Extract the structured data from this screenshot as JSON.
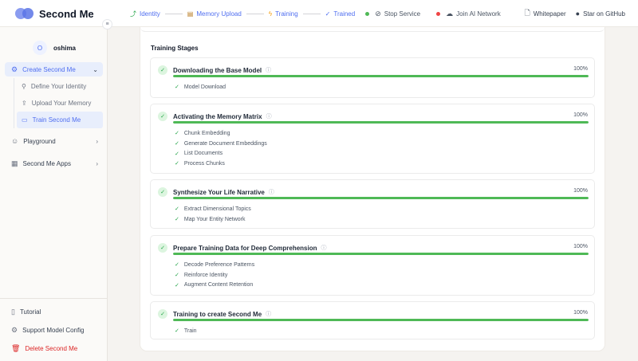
{
  "app": {
    "name": "Second Me"
  },
  "header": {
    "steps": [
      {
        "icon": "chart-up-icon",
        "label": "Identity"
      },
      {
        "icon": "memory-icon",
        "label": "Memory Upload"
      },
      {
        "icon": "bolt-icon",
        "label": "Training"
      },
      {
        "icon": "check-icon",
        "label": "Trained"
      }
    ],
    "actions": [
      {
        "label": "Stop Service",
        "dot_color": "#4fb956"
      },
      {
        "label": "Join AI Network",
        "dot_color": "#ef4444"
      }
    ],
    "links": [
      {
        "label": "Whitepaper"
      },
      {
        "label": "Star on GitHub"
      }
    ]
  },
  "sidebar": {
    "user": {
      "avatar_letter": "O",
      "name": "oshima"
    },
    "create": {
      "label": "Create Second Me",
      "children": [
        {
          "label": "Define Your Identity"
        },
        {
          "label": "Upload Your Memory"
        },
        {
          "label": "Train Second Me"
        }
      ]
    },
    "playground": {
      "label": "Playground"
    },
    "apps": {
      "label": "Second Me Apps"
    },
    "bottom": [
      {
        "label": "Tutorial"
      },
      {
        "label": "Support Model Config"
      },
      {
        "label": "Delete Second Me"
      }
    ]
  },
  "main": {
    "section_title": "Training Stages",
    "stages": [
      {
        "name": "Downloading the Base Model",
        "percent_text": "100%",
        "progress": 1.0,
        "tasks": [
          "Model Download"
        ]
      },
      {
        "name": "Activating the Memory Matrix",
        "percent_text": "100%",
        "progress": 1.0,
        "tasks": [
          "Chunk Embedding",
          "Generate Document Embeddings",
          "List Documents",
          "Process Chunks"
        ]
      },
      {
        "name": "Synthesize Your Life Narrative",
        "percent_text": "100%",
        "progress": 1.0,
        "tasks": [
          "Extract Dimensional Topics",
          "Map Your Entity Network"
        ]
      },
      {
        "name": "Prepare Training Data for Deep Comprehension",
        "percent_text": "100%",
        "progress": 1.0,
        "tasks": [
          "Decode Preference Patterns",
          "Reinforce Identity",
          "Augment Content Retention"
        ]
      },
      {
        "name": "Training to create Second Me",
        "percent_text": "100%",
        "progress": 1.0,
        "tasks": [
          "Train"
        ]
      }
    ]
  },
  "colors": {
    "accent": "#4f6ef0",
    "success": "#4fb956",
    "danger": "#dc2626"
  }
}
